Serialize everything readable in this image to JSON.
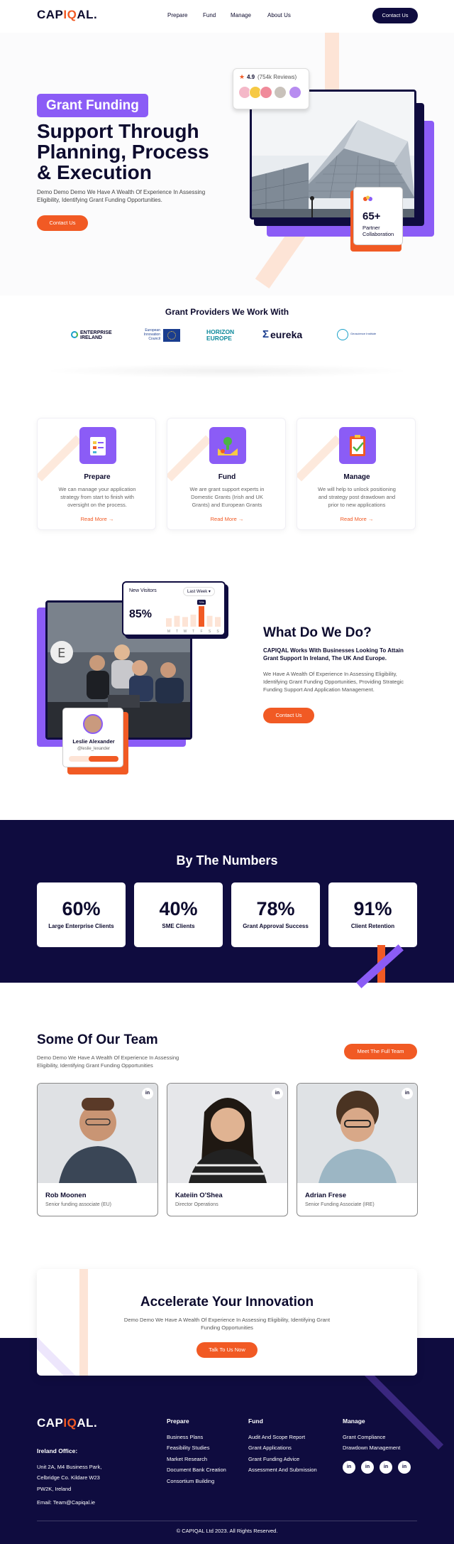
{
  "header": {
    "logo_pre": "CAP",
    "logo_q": "IQ",
    "logo_post": "AL.",
    "nav": [
      "Prepare",
      "Fund",
      "Manage",
      "About Us"
    ],
    "contact": "Contact Us"
  },
  "hero": {
    "pill": "Grant Funding",
    "title": "Support Through Planning, Process & Execution",
    "text": "Demo Demo Demo We Have A Wealth Of Experience In Assessing Eligibility, Identifying Grant Funding Opportunities.",
    "cta": "Contact Us",
    "rating": "4.9",
    "reviews": "(754k Reviews)",
    "stat_value": "65+",
    "stat_label": "Partner Collaboration"
  },
  "providers": {
    "title": "Grant Providers We Work With",
    "logos": [
      "ENTERPRISE IRELAND",
      "European Innovation Council",
      "HORIZON EUROPE",
      "eureka",
      "Geoscience Institute"
    ]
  },
  "services": [
    {
      "title": "Prepare",
      "text": "We can manage your application strategy from start to finish with oversight on the process.",
      "link": "Read More"
    },
    {
      "title": "Fund",
      "text": "We are grant support experts in Domestic Grants (Irish and UK Grants) and European Grants",
      "link": "Read More"
    },
    {
      "title": "Manage",
      "text": "We will help to unlock positioning and strategy post drawdown and prior to new applications",
      "link": "Read More"
    }
  ],
  "what": {
    "title": "What Do We Do?",
    "lead": "CAPIQAL Works With Businesses Looking To Attain Grant Support In Ireland, The UK And Europe.",
    "text": "We Have A Wealth Of Experience In Assessing Eligibility, Identifying Grant Funding Opportunities, Providing Strategic Funding Support And Application Management.",
    "cta": "Contact Us",
    "visitors_title": "New Visitors",
    "visitors_range": "Last Week",
    "visitors_pct": "85%",
    "visitors_tag": "70%",
    "visitors_days": [
      "M",
      "T",
      "W",
      "T",
      "F",
      "S",
      "S"
    ],
    "visitors_values": [
      0.35,
      0.45,
      0.4,
      0.5,
      0.85,
      0.45,
      0.4
    ],
    "person_name": "Leslie Alexander",
    "person_handle": "@leslie_lexander"
  },
  "numbers": {
    "title": "By The Numbers",
    "items": [
      {
        "value": "60%",
        "label": "Large Enterprise Clients"
      },
      {
        "value": "40%",
        "label": "SME Clients"
      },
      {
        "value": "78%",
        "label": "Grant Approval Success"
      },
      {
        "value": "91%",
        "label": "Client Retention"
      }
    ]
  },
  "team": {
    "title": "Some Of Our Team",
    "text": "Demo Demo We Have A Wealth Of Experience In Assessing Eligibility, Identifying Grant Funding Opportunities",
    "cta": "Meet The Full Team",
    "members": [
      {
        "name": "Rob Moonen",
        "role": "Senior funding associate (EU)"
      },
      {
        "name": "Kateiin O'Shea",
        "role": "Director Operations"
      },
      {
        "name": "Adrian Frese",
        "role": "Senior Funding Associate (IRE)"
      }
    ]
  },
  "accelerate": {
    "title": "Accelerate Your Innovation",
    "text": "Demo Demo We Have A Wealth Of Experience In Assessing Eligibility, Identifying Grant Funding Opportunities",
    "cta": "Talk To Us Now"
  },
  "footer": {
    "office_title": "Ireland Office:",
    "address": [
      "Unit 2A, M4 Business Park,",
      "Celbridge Co. Kildare W23",
      "PW2K, Ireland"
    ],
    "email": "Email: Team@Capiqal.ie",
    "cols": [
      {
        "head": "Prepare",
        "items": [
          "Business Plans",
          "Feasibility Studies",
          "Market Research",
          "Document Bank Creation",
          "Consortium Building"
        ]
      },
      {
        "head": "Fund",
        "items": [
          "Audit And Scope Report",
          "Grant Applications",
          "Grant Funding Advice",
          "Assessment And Submission"
        ]
      },
      {
        "head": "Manage",
        "items": [
          "Grant Compliance",
          "Drawdown Management"
        ]
      }
    ],
    "social": [
      "in",
      "in",
      "in",
      "in"
    ],
    "copyright": "© CAPIQAL Ltd 2023. All Rights Reserved."
  },
  "colors": {
    "navy": "#0f0c3f",
    "purple": "#8b5cf6",
    "orange": "#f15a24"
  }
}
